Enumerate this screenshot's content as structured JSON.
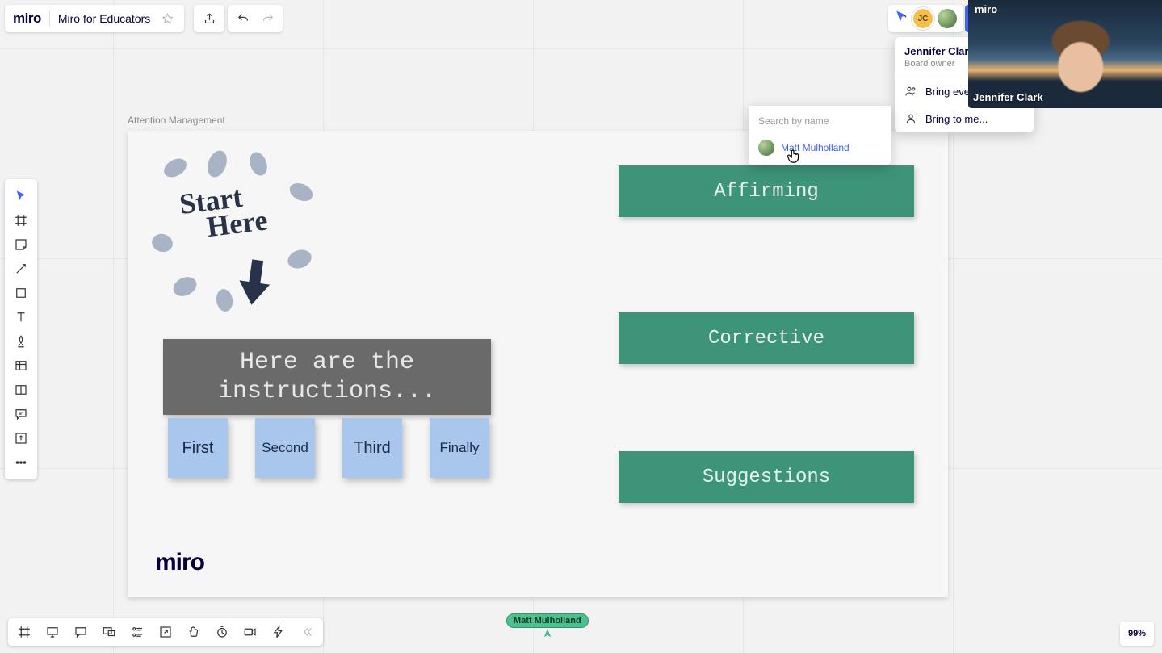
{
  "header": {
    "logo_text": "miro",
    "board_name": "Miro for Educators"
  },
  "presence": {
    "user_name": "Jennifer Clark (yo",
    "user_role": "Board owner",
    "menu_bring_everyone": "Bring everyo",
    "menu_bring_to_me": "Bring to me..."
  },
  "search": {
    "placeholder": "Search by name",
    "result_name": "Matt Mulholland"
  },
  "webcam": {
    "brand": "miro",
    "name": "Jennifer Clark"
  },
  "canvas": {
    "frame_title": "Attention Management",
    "starthere_line1": "Start",
    "starthere_line2": "Here",
    "instructions_text": "Here are the instructions...",
    "stickies": [
      "First",
      "Second",
      "Third",
      "Finally"
    ],
    "cards": [
      "Affirming",
      "Corrective",
      "Suggestions"
    ],
    "frame_logo": "miro"
  },
  "remote_cursor": {
    "name": "Matt Mulholland"
  },
  "zoom": {
    "level": "99%"
  }
}
